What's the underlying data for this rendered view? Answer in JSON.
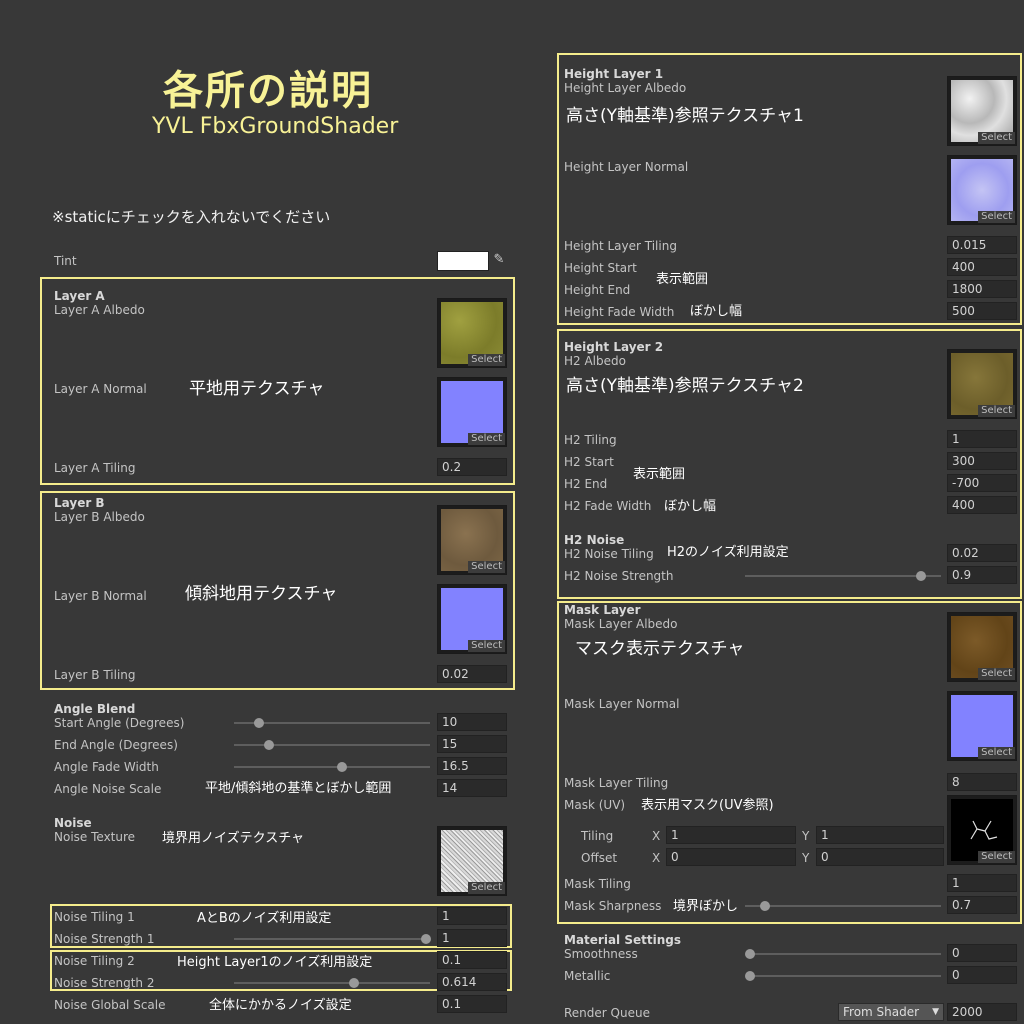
{
  "page": {
    "title": "各所の説明",
    "subtitle": "YVL FbxGroundShader",
    "note": "※staticにチェックを入れないでください"
  },
  "tint": {
    "label": "Tint",
    "color": "#ffffff"
  },
  "layer_a": {
    "header": "Layer A",
    "albedo_label": "Layer A Albedo",
    "normal_label": "Layer A Normal",
    "tiling_label": "Layer A Tiling",
    "tiling_value": "0.2",
    "annotation": "平地用テクスチャ",
    "albedo_color": "#8c8c32",
    "normal_color": "#8080ff"
  },
  "layer_b": {
    "header": "Layer B",
    "albedo_label": "Layer B Albedo",
    "normal_label": "Layer B Normal",
    "tiling_label": "Layer B Tiling",
    "tiling_value": "0.02",
    "annotation": "傾斜地用テクスチャ",
    "albedo_color": "#806a4a",
    "normal_color": "#8080ff"
  },
  "angle_blend": {
    "header": "Angle Blend",
    "start_label": "Start Angle (Degrees)",
    "start_value": "10",
    "start_fraction": 0.13,
    "end_label": "End Angle (Degrees)",
    "end_value": "15",
    "end_fraction": 0.18,
    "fade_label": "Angle Fade Width",
    "fade_value": "16.5",
    "fade_fraction": 0.55,
    "noise_label": "Angle Noise Scale",
    "noise_value": "14",
    "annotation": "平地/傾斜地の基準とぼかし範囲"
  },
  "noise": {
    "header": "Noise",
    "texture_label": "Noise Texture",
    "annotation": "境界用ノイズテクスチャ",
    "tiling1_label": "Noise Tiling 1",
    "tiling1_value": "1",
    "strength1_label": "Noise Strength 1",
    "strength1_value": "1",
    "strength1_fraction": 1.0,
    "annotation_ab": "AとBのノイズ利用設定",
    "tiling2_label": "Noise Tiling 2",
    "tiling2_value": "0.1",
    "strength2_label": "Noise Strength 2",
    "strength2_value": "0.614",
    "strength2_fraction": 0.614,
    "annotation_h1": "Height Layer1のノイズ利用設定",
    "global_label": "Noise Global Scale",
    "global_value": "0.1",
    "annotation_global": "全体にかかるノイズ設定"
  },
  "height_layer1": {
    "header": "Height Layer 1",
    "albedo_label": "Height Layer Albedo",
    "annotation": "高さ(Y軸基準)参照テクスチャ1",
    "normal_label": "Height Layer Normal",
    "tiling_label": "Height Layer Tiling",
    "tiling_value": "0.015",
    "start_label": "Height Start",
    "start_value": "400",
    "end_label": "Height End",
    "end_value": "1800",
    "fade_label": "Height Fade Width",
    "fade_value": "500",
    "range_annotation": "表示範囲",
    "blur_annotation": "ぼかし幅",
    "albedo_color": "#cfcfcf",
    "normal_color": "#aaaaf0"
  },
  "height_layer2": {
    "header": "Height Layer 2",
    "albedo_label": "H2 Albedo",
    "annotation": "高さ(Y軸基準)参照テクスチャ2",
    "tiling_label": "H2 Tiling",
    "tiling_value": "1",
    "start_label": "H2 Start",
    "start_value": "300",
    "end_label": "H2 End",
    "end_value": "-700",
    "fade_label": "H2 Fade Width",
    "fade_value": "400",
    "range_annotation": "表示範囲",
    "blur_annotation": "ぼかし幅",
    "noise_header": "H2 Noise",
    "noise_tiling_label": "H2 Noise Tiling",
    "noise_tiling_value": "0.02",
    "noise_annotation": "H2のノイズ利用設定",
    "noise_strength_label": "H2 Noise Strength",
    "noise_strength_value": "0.9",
    "noise_strength_fraction": 0.9,
    "albedo_color": "#7a6a30"
  },
  "mask_layer": {
    "header": "Mask Layer",
    "albedo_label": "Mask Layer Albedo",
    "annotation": "マスク表示テクスチャ",
    "normal_label": "Mask Layer Normal",
    "tiling_label": "Mask Layer Tiling",
    "tiling_value": "8",
    "mask_uv_label": "Mask (UV)",
    "mask_uv_annotation": "表示用マスク(UV参照)",
    "tiling_sub_label": "Tiling",
    "tiling_x": "1",
    "tiling_y": "1",
    "offset_sub_label": "Offset",
    "offset_x": "0",
    "offset_y": "0",
    "x_label": "X",
    "y_label": "Y",
    "mask_tiling_label": "Mask Tiling",
    "mask_tiling_value": "1",
    "sharpness_label": "Mask Sharpness",
    "sharpness_value": "0.7",
    "sharpness_fraction": 0.1,
    "sharpness_annotation": "境界ぼかし",
    "albedo_color": "#6e4e22",
    "normal_color": "#8080ff"
  },
  "material": {
    "header": "Material Settings",
    "smoothness_label": "Smoothness",
    "smoothness_value": "0",
    "smoothness_fraction": 0,
    "metallic_label": "Metallic",
    "metallic_value": "0",
    "metallic_fraction": 0,
    "render_queue_label": "Render Queue",
    "render_queue_mode": "From Shader",
    "render_queue_value": "2000"
  },
  "select_label": "Select",
  "colors": {
    "highlight_border": "#f5ec8c",
    "panel_bg": "#383838",
    "title": "#f8f296"
  }
}
